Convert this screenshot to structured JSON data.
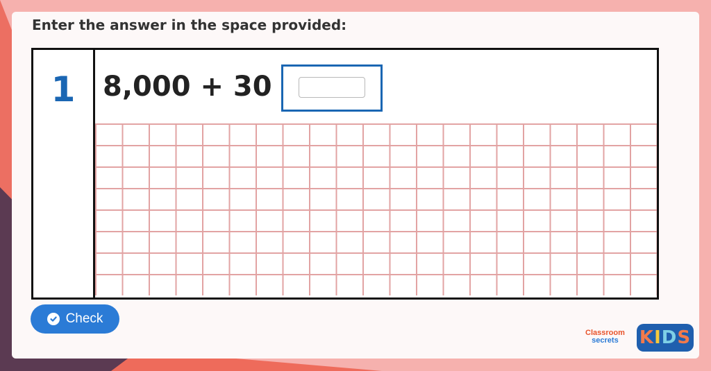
{
  "instruction": "Enter the answer in the space provided:",
  "question": {
    "number": "1",
    "equation": "8,000 + 30 =",
    "answer_value": ""
  },
  "check_button": {
    "label": "Check",
    "icon": "check-circle-icon"
  },
  "branding": {
    "classroom_line1": "Classroom",
    "classroom_line2": "secrets",
    "kids_letters": [
      "K",
      "I",
      "D",
      "S"
    ]
  },
  "colors": {
    "accent_blue": "#2b7bd6",
    "question_number": "#1a66b3",
    "grid_line": "#e2a3a3",
    "background_pink": "#f6b1ae",
    "background_coral": "#ec6f62",
    "background_dark": "#5b3a52"
  }
}
